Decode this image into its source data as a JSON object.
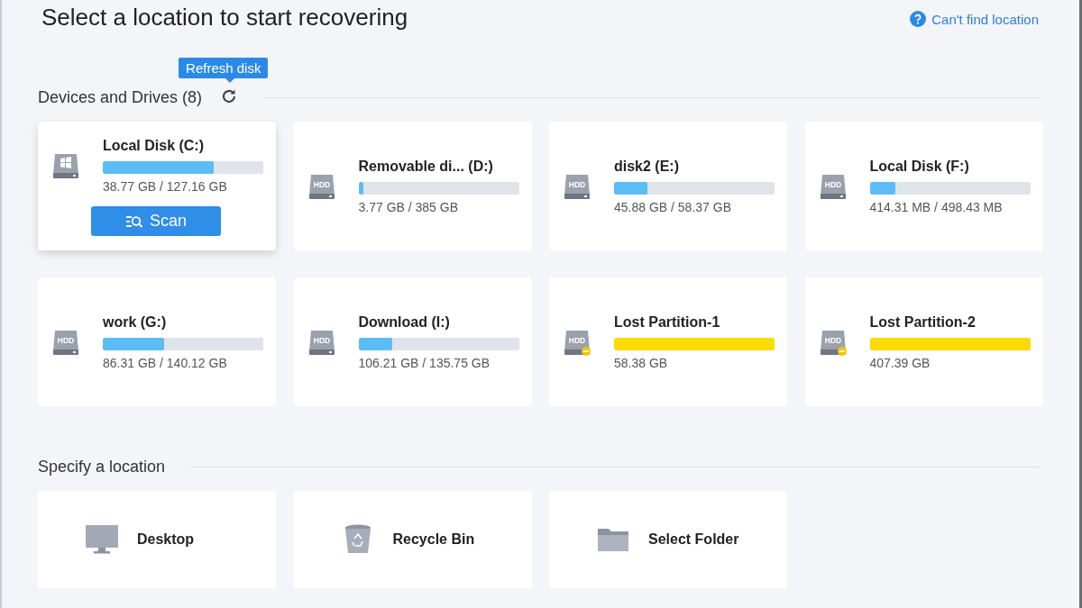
{
  "header": {
    "title": "Select a location to start recovering",
    "help_link": "Can't find location"
  },
  "devices": {
    "heading": "Devices and Drives (8)",
    "refresh_tooltip": "Refresh disk",
    "drives": [
      {
        "name": "Local Disk (C:)",
        "usage": "38.77 GB / 127.16 GB",
        "level": 0.69,
        "kind": "system",
        "selected": true,
        "action": "Scan"
      },
      {
        "name": "Removable di... (D:)",
        "usage": "3.77 GB /  385 GB",
        "level": 0.03,
        "kind": "hdd",
        "badge": "HDD",
        "selected": false
      },
      {
        "name": "disk2 (E:)",
        "usage": "45.88 GB / 58.37 GB",
        "level": 0.21,
        "kind": "hdd",
        "badge": "HDD",
        "selected": false
      },
      {
        "name": "Local Disk (F:)",
        "usage": "414.31 MB / 498.43 MB",
        "level": 0.16,
        "kind": "hdd",
        "badge": "HDD",
        "selected": false
      },
      {
        "name": "work (G:)",
        "usage": "86.31 GB / 140.12 GB",
        "level": 0.38,
        "kind": "hdd",
        "badge": "HDD",
        "selected": false
      },
      {
        "name": "Download (I:)",
        "usage": "106.21 GB / 135.75 GB",
        "level": 0.21,
        "kind": "hdd",
        "badge": "HDD",
        "selected": false
      },
      {
        "name": "Lost Partition-1",
        "usage": "58.38 GB",
        "level": 1,
        "kind": "lost",
        "badge": "HDD",
        "selected": false
      },
      {
        "name": "Lost Partition-2",
        "usage": "407.39 GB",
        "level": 1,
        "kind": "lost",
        "badge": "HDD",
        "selected": false
      }
    ]
  },
  "locations": {
    "heading": "Specify a location",
    "items": [
      {
        "label": "Desktop",
        "kind": "desktop"
      },
      {
        "label": "Recycle Bin",
        "kind": "recycle"
      },
      {
        "label": "Select Folder",
        "kind": "folder"
      }
    ]
  }
}
